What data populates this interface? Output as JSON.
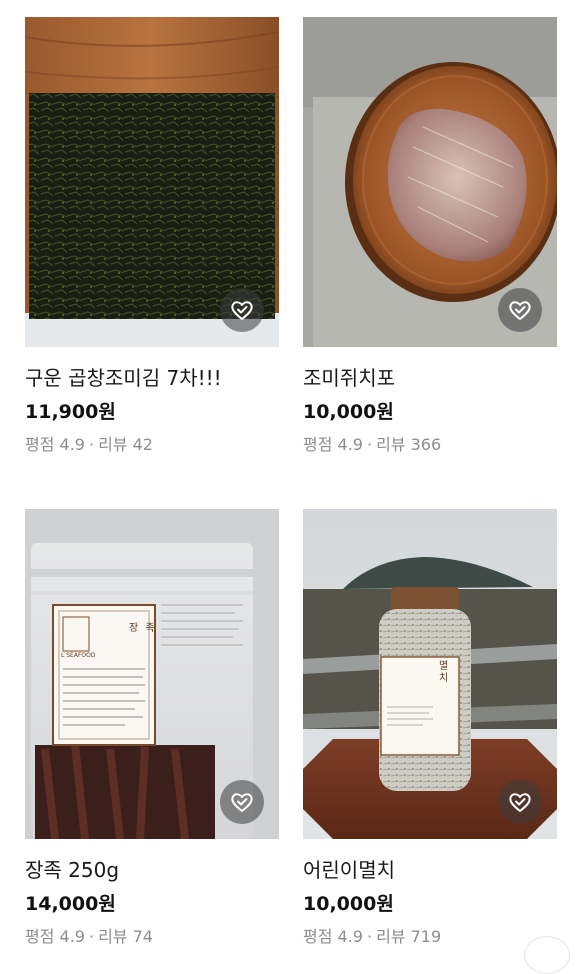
{
  "products": [
    {
      "name": "구운 곱창조미김 7차!!!",
      "price": "11,900원",
      "rating_label": "평점 4.9",
      "review_label": "리뷰 42",
      "icon": "heart-check-icon"
    },
    {
      "name": "조미쥐치포",
      "price": "10,000원",
      "rating_label": "평점 4.9",
      "review_label": "리뷰 366",
      "icon": "heart-check-icon"
    },
    {
      "name": "장족 250g",
      "price": "14,000원",
      "rating_label": "평점 4.9",
      "review_label": "리뷰 74",
      "icon": "heart-check-icon",
      "package_label": "장 족",
      "package_brand": "L SEAFOOD"
    },
    {
      "name": "어린이멸치",
      "price": "10,000원",
      "rating_label": "평점 4.9",
      "review_label": "리뷰 719",
      "icon": "heart-check-icon",
      "package_label": "멸 치"
    }
  ],
  "separator": "·",
  "colors": {
    "text_primary": "#111111",
    "text_muted": "#8d8d8d",
    "like_button_bg": "#3c3c3c"
  }
}
